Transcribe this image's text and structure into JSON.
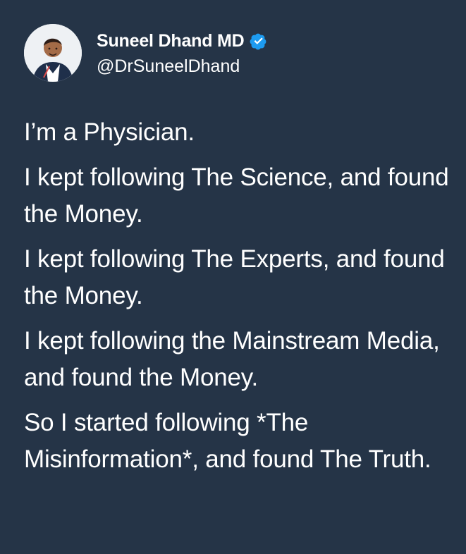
{
  "tweet": {
    "author": {
      "display_name": "Suneel Dhand MD",
      "handle": "@DrSuneelDhand",
      "verified": true,
      "avatar_icon": "doctor-avatar",
      "verified_icon": "verified-badge-icon"
    },
    "paragraphs": [
      "I’m a Physician.",
      "I kept following The Science, and found the Money.",
      "I kept following The Experts, and found the Money.",
      "I kept following the Mainstream Media, and found the Money.",
      "So I started following *The Misinformation*, and found The Truth."
    ]
  },
  "colors": {
    "background": "#253447",
    "text": "#ffffff",
    "verified_badge": "#1d9bf0"
  }
}
